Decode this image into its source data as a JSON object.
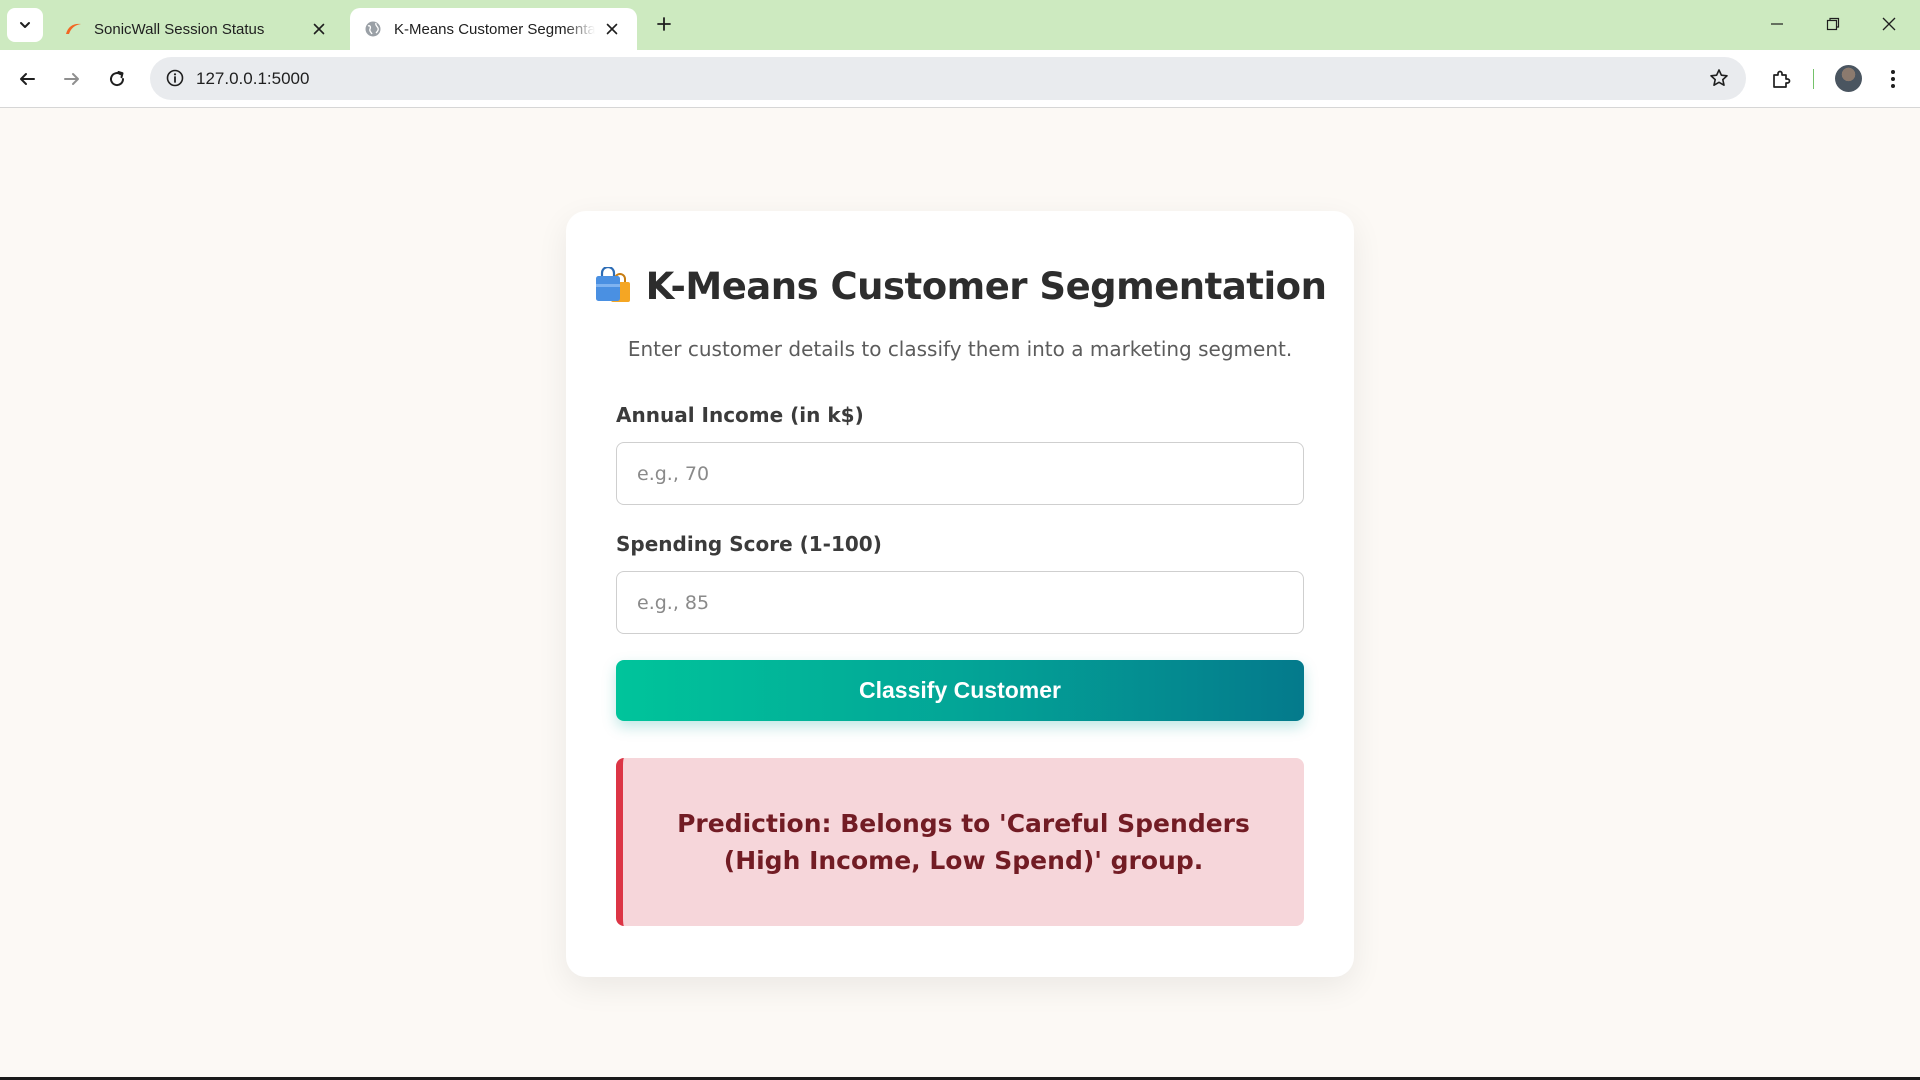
{
  "browser": {
    "tabs": [
      {
        "title": "SonicWall Session Status",
        "active": false,
        "favicon": "sonicwall-swoosh-icon"
      },
      {
        "title": "K-Means Customer Segmentation",
        "active": true,
        "favicon": "globe-icon"
      }
    ],
    "address": {
      "url": "127.0.0.1:5000"
    },
    "colors": {
      "tab_strip": "#cdeac0",
      "toolbar": "#ffffff",
      "omnibox": "#e9ebee"
    }
  },
  "page": {
    "title_emoji": "shopping-bags-icon",
    "title": "K-Means Customer Segmentation",
    "subtitle": "Enter customer details to classify them into a marketing segment.",
    "form": {
      "income_label": "Annual Income (in k$)",
      "income_placeholder": "e.g., 70",
      "income_value": "",
      "score_label": "Spending Score (1-100)",
      "score_placeholder": "e.g., 85",
      "score_value": "",
      "submit_label": "Classify Customer"
    },
    "result": {
      "text": "Prediction: Belongs to 'Careful Spenders (High Income, Low Spend)' group."
    },
    "colors": {
      "background": "#fcf9f5",
      "button_gradient_start": "#00c49b",
      "button_gradient_end": "#047a8c",
      "result_background": "#f6d6da",
      "result_border": "#dc3545",
      "result_text": "#721c24"
    }
  }
}
